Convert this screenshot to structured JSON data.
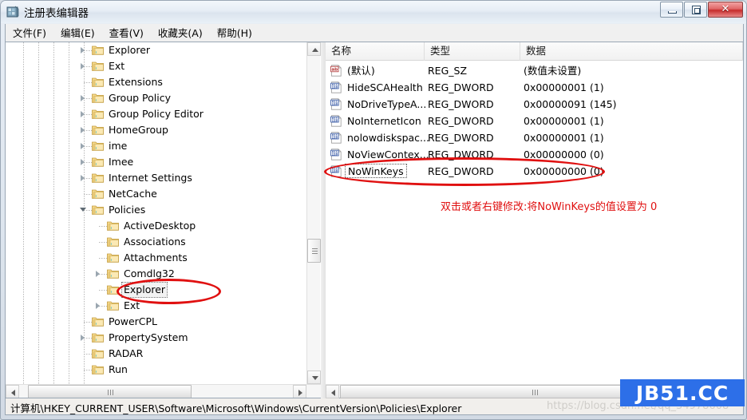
{
  "window": {
    "title": "注册表编辑器",
    "icon": "registry-editor-icon",
    "minimize_label": "最小化",
    "maximize_label": "还原",
    "close_label": "✕"
  },
  "menubar": {
    "items": [
      {
        "label": "文件(F)"
      },
      {
        "label": "编辑(E)"
      },
      {
        "label": "查看(V)"
      },
      {
        "label": "收藏夹(A)"
      },
      {
        "label": "帮助(H)"
      }
    ]
  },
  "tree": {
    "items": [
      {
        "label": "Explorer",
        "indent": 5,
        "expander": "collapsed",
        "selected": false
      },
      {
        "label": "Ext",
        "indent": 5,
        "expander": "collapsed",
        "selected": false
      },
      {
        "label": "Extensions",
        "indent": 5,
        "expander": "none",
        "selected": false
      },
      {
        "label": "Group Policy",
        "indent": 5,
        "expander": "collapsed",
        "selected": false
      },
      {
        "label": "Group Policy Editor",
        "indent": 5,
        "expander": "collapsed",
        "selected": false
      },
      {
        "label": "HomeGroup",
        "indent": 5,
        "expander": "collapsed",
        "selected": false
      },
      {
        "label": "ime",
        "indent": 5,
        "expander": "collapsed",
        "selected": false
      },
      {
        "label": "Imee",
        "indent": 5,
        "expander": "collapsed",
        "selected": false
      },
      {
        "label": "Internet Settings",
        "indent": 5,
        "expander": "collapsed",
        "selected": false
      },
      {
        "label": "NetCache",
        "indent": 5,
        "expander": "none",
        "selected": false
      },
      {
        "label": "Policies",
        "indent": 5,
        "expander": "expanded",
        "selected": false
      },
      {
        "label": "ActiveDesktop",
        "indent": 6,
        "expander": "none",
        "selected": false
      },
      {
        "label": "Associations",
        "indent": 6,
        "expander": "none",
        "selected": false
      },
      {
        "label": "Attachments",
        "indent": 6,
        "expander": "none",
        "selected": false
      },
      {
        "label": "Comdlg32",
        "indent": 6,
        "expander": "collapsed",
        "selected": false
      },
      {
        "label": "Explorer",
        "indent": 6,
        "expander": "none",
        "selected": true
      },
      {
        "label": "Ext",
        "indent": 6,
        "expander": "collapsed",
        "selected": false
      },
      {
        "label": "PowerCPL",
        "indent": 5,
        "expander": "none",
        "selected": false
      },
      {
        "label": "PropertySystem",
        "indent": 5,
        "expander": "collapsed",
        "selected": false
      },
      {
        "label": "RADAR",
        "indent": 5,
        "expander": "none",
        "selected": false
      },
      {
        "label": "Run",
        "indent": 5,
        "expander": "none",
        "selected": false
      }
    ]
  },
  "list": {
    "columns": [
      {
        "label": "名称"
      },
      {
        "label": "类型"
      },
      {
        "label": "数据"
      }
    ],
    "rows": [
      {
        "name": "(默认)",
        "type": "REG_SZ",
        "data": "(数值未设置)",
        "icon": "string-value-icon",
        "focused": false
      },
      {
        "name": "HideSCAHealth",
        "type": "REG_DWORD",
        "data": "0x00000001 (1)",
        "icon": "dword-value-icon",
        "focused": false
      },
      {
        "name": "NoDriveTypeA...",
        "type": "REG_DWORD",
        "data": "0x00000091 (145)",
        "icon": "dword-value-icon",
        "focused": false
      },
      {
        "name": "NoInternetIcon",
        "type": "REG_DWORD",
        "data": "0x00000001 (1)",
        "icon": "dword-value-icon",
        "focused": false
      },
      {
        "name": "nolowdiskspac...",
        "type": "REG_DWORD",
        "data": "0x00000001 (1)",
        "icon": "dword-value-icon",
        "focused": false
      },
      {
        "name": "NoViewContex...",
        "type": "REG_DWORD",
        "data": "0x00000000 (0)",
        "icon": "dword-value-icon",
        "focused": false
      },
      {
        "name": "NoWinKeys",
        "type": "REG_DWORD",
        "data": "0x00000000 (0)",
        "icon": "dword-value-icon",
        "focused": true
      }
    ]
  },
  "annotation": {
    "text": "双击或者右键修改:将NoWinKeys的值设置为 0",
    "color": "#e01010"
  },
  "statusbar": {
    "path": "计算机\\HKEY_CURRENT_USER\\Software\\Microsoft\\Windows\\CurrentVersion\\Policies\\Explorer"
  },
  "watermark": {
    "badge": "JB51.CC",
    "badge_color": "#2d6fe8",
    "faint": "https://blog.csdn.net/qq_34978608"
  }
}
